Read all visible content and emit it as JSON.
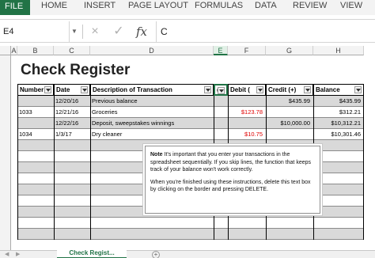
{
  "ribbon": {
    "file_label": "FILE",
    "tabs": [
      "HOME",
      "INSERT",
      "PAGE LAYOUT",
      "FORMULAS",
      "DATA",
      "REVIEW",
      "VIEW"
    ]
  },
  "formula_bar": {
    "name_box": "E4",
    "cancel_icon": "×",
    "enter_icon": "✓",
    "fx_label": "fx",
    "formula": "C"
  },
  "columns": [
    "A",
    "B",
    "C",
    "D",
    "E",
    "F",
    "G",
    "H"
  ],
  "selected_column": "E",
  "sheet": {
    "title": "Check Register",
    "headers": {
      "number": "Number",
      "date": "Date",
      "description": "Description of Transaction",
      "c": "C",
      "debit": "Debit  (",
      "credit": "Credit (+)",
      "balance": "Balance"
    },
    "rows": [
      {
        "number": "",
        "date": "12/20/16",
        "description": "Previous balance",
        "debit": "",
        "credit": "$435.99",
        "balance": "$435.99"
      },
      {
        "number": "1033",
        "date": "12/21/16",
        "description": "Groceries",
        "debit": "$123.78",
        "credit": "",
        "balance": "$312.21"
      },
      {
        "number": "",
        "date": "12/22/16",
        "description": "Deposit, sweepstakes winnings",
        "debit": "",
        "credit": "$10,000.00",
        "balance": "$10,312.21"
      },
      {
        "number": "1034",
        "date": "1/3/17",
        "description": "Dry cleaner",
        "debit": "$10.75",
        "credit": "",
        "balance": "$10,301.46"
      }
    ]
  },
  "note": {
    "bold": "Note",
    "text1": " It's important that you enter your transactions in the spreadsheet sequentially. If you skip lines, the function that keeps track of your balance won't work correctly.",
    "text2": "When you're finished using these instructions, delete this text box by clicking on the border and pressing DELETE."
  },
  "sheet_tabs": {
    "active": "Check Regist..."
  },
  "colors": {
    "excel_green": "#217346",
    "negative": "#e00000",
    "row_shade": "#d9d9d9"
  }
}
